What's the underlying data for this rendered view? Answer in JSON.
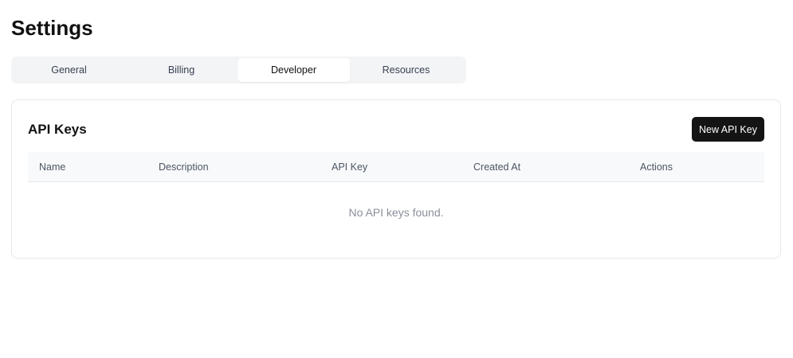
{
  "page": {
    "title": "Settings"
  },
  "tabs": [
    {
      "label": "General",
      "active": false
    },
    {
      "label": "Billing",
      "active": false
    },
    {
      "label": "Developer",
      "active": true
    },
    {
      "label": "Resources",
      "active": false
    }
  ],
  "api_keys": {
    "title": "API Keys",
    "new_button_label": "New API Key",
    "columns": [
      "Name",
      "Description",
      "API Key",
      "Created At",
      "Actions"
    ],
    "rows": [],
    "empty_message": "No API keys found."
  },
  "colors": {
    "primary_button": "#141414",
    "tab_bar_bg": "#f3f4f6",
    "table_header_bg": "#f8f9fa",
    "border": "#e5e7eb",
    "muted_text": "#8a8f98"
  }
}
